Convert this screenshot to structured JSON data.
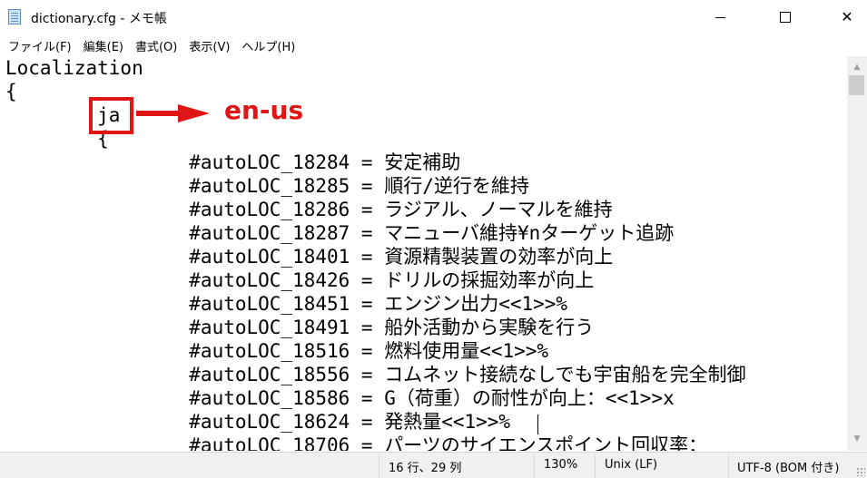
{
  "window": {
    "title": "dictionary.cfg - メモ帳",
    "minimize_icon": "minimize-icon",
    "maximize_icon": "maximize-icon",
    "close_icon": "close-icon",
    "close_glyph": "✕"
  },
  "menu": [
    "ファイル(F)",
    "編集(E)",
    "書式(O)",
    "表示(V)",
    "ヘルプ(H)"
  ],
  "editor": {
    "lines": [
      "Localization",
      "{",
      "        ja",
      "        {",
      "                #autoLOC_18284 = 安定補助",
      "                #autoLOC_18285 = 順行/逆行を維持",
      "                #autoLOC_18286 = ラジアル、ノーマルを維持",
      "                #autoLOC_18287 = マニューバ維持¥nターゲット追跡",
      "                #autoLOC_18401 = 資源精製装置の効率が向上",
      "                #autoLOC_18426 = ドリルの採掘効率が向上",
      "                #autoLOC_18451 = エンジン出力<<1>>%",
      "                #autoLOC_18491 = 船外活動から実験を行う",
      "                #autoLOC_18516 = 燃料使用量<<1>>%",
      "                #autoLOC_18556 = コムネット接続なしでも宇宙船を完全制御",
      "                #autoLOC_18586 = G（荷重）の耐性が向上：<<1>>x",
      "                #autoLOC_18624 = 発熱量<<1>>%",
      "                #autoLOC_18706 = パーツのサイエンスポイント回収率："
    ]
  },
  "annotation": {
    "label": "en-us",
    "color": "#e01616"
  },
  "status": {
    "position": "16 行、29 列",
    "zoom": "130%",
    "line_ending": "Unix (LF)",
    "encoding": "UTF-8 (BOM 付き)"
  },
  "scrollbar": {
    "up_glyph": "▲",
    "down_glyph": "▼"
  }
}
